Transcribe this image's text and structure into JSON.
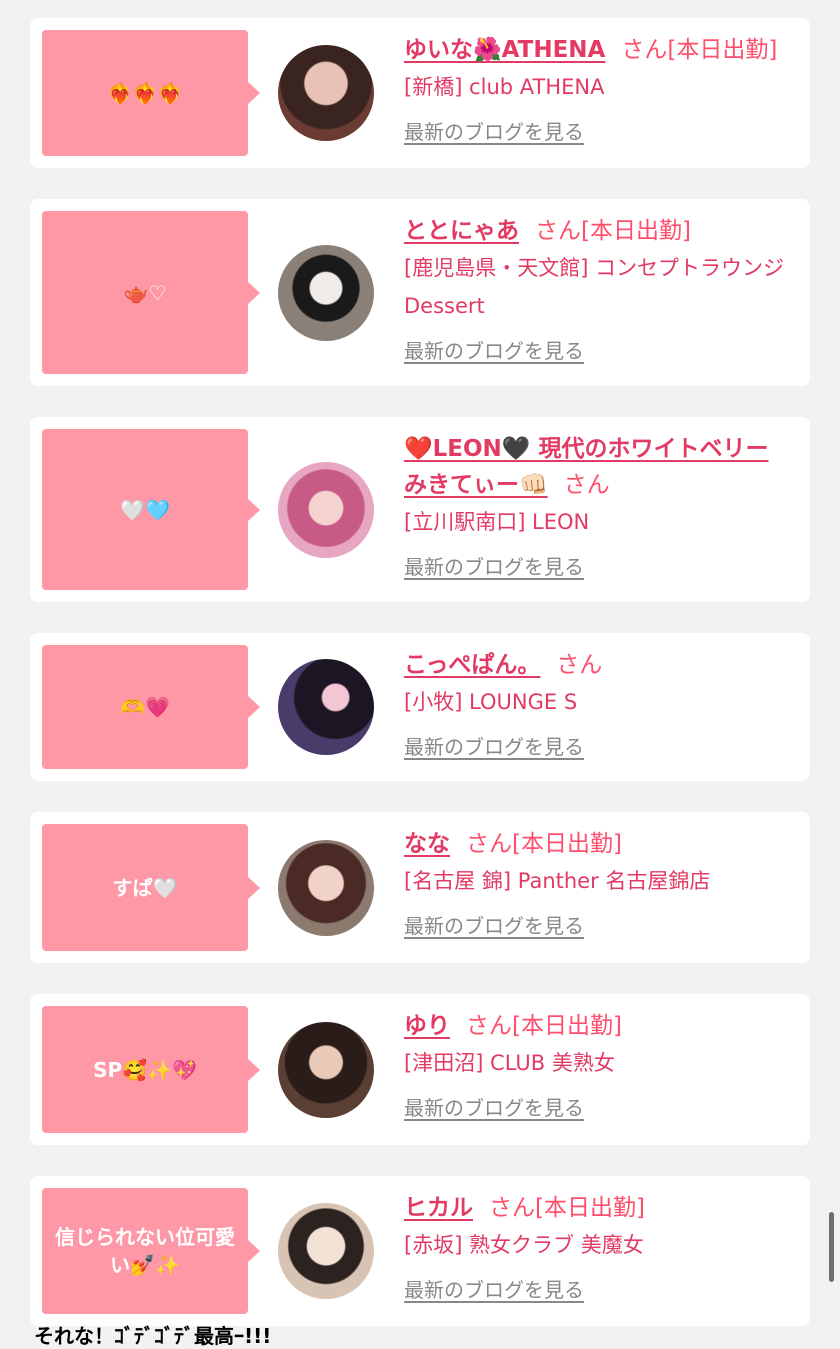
{
  "colors": {
    "accent": "#e23a63",
    "bubble": "#ff98a6",
    "background": "#f2f2f2"
  },
  "cards": [
    {
      "bubble_text": "❤️‍🔥❤️‍🔥❤️‍🔥",
      "name": "ゆいな🌺ATHENA",
      "suffix": "さん[本日出勤]",
      "shop": "[新橋] club ATHENA",
      "blog_link": "最新のブログを見る"
    },
    {
      "bubble_text": "🫖♡",
      "name": "ととにゃあ",
      "suffix": "さん[本日出勤]",
      "shop": "[鹿児島県・天文館] コンセプトラウンジ Dessert",
      "blog_link": "最新のブログを見る"
    },
    {
      "bubble_text": "🤍🩵",
      "name": "❤️LEON🖤 現代のホワイトベリー みきてぃー👊🏻",
      "suffix": "さん",
      "shop": "[立川駅南口] LEON",
      "blog_link": "最新のブログを見る"
    },
    {
      "bubble_text": "🫶💗",
      "name": "こっぺぱん。",
      "suffix": "さん",
      "shop": "[小牧] LOUNGE S",
      "blog_link": "最新のブログを見る"
    },
    {
      "bubble_text": "すぱ🤍",
      "name": "なな",
      "suffix": "さん[本日出勤]",
      "shop": "[名古屋 錦] Panther 名古屋錦店",
      "blog_link": "最新のブログを見る"
    },
    {
      "bubble_text": "SP🥰✨💖",
      "name": "ゆり",
      "suffix": "さん[本日出勤]",
      "shop": "[津田沼] CLUB 美熟女",
      "blog_link": "最新のブログを見る"
    },
    {
      "bubble_text": "信じられない位可愛い💅✨",
      "name": "ヒカル",
      "suffix": "さん[本日出勤]",
      "shop": "[赤坂] 熟女クラブ 美魔女",
      "blog_link": "最新のブログを見る"
    }
  ],
  "caption": "それな！ｺﾞﾃﾞｺﾞﾃﾞ最高ｰ!!!"
}
